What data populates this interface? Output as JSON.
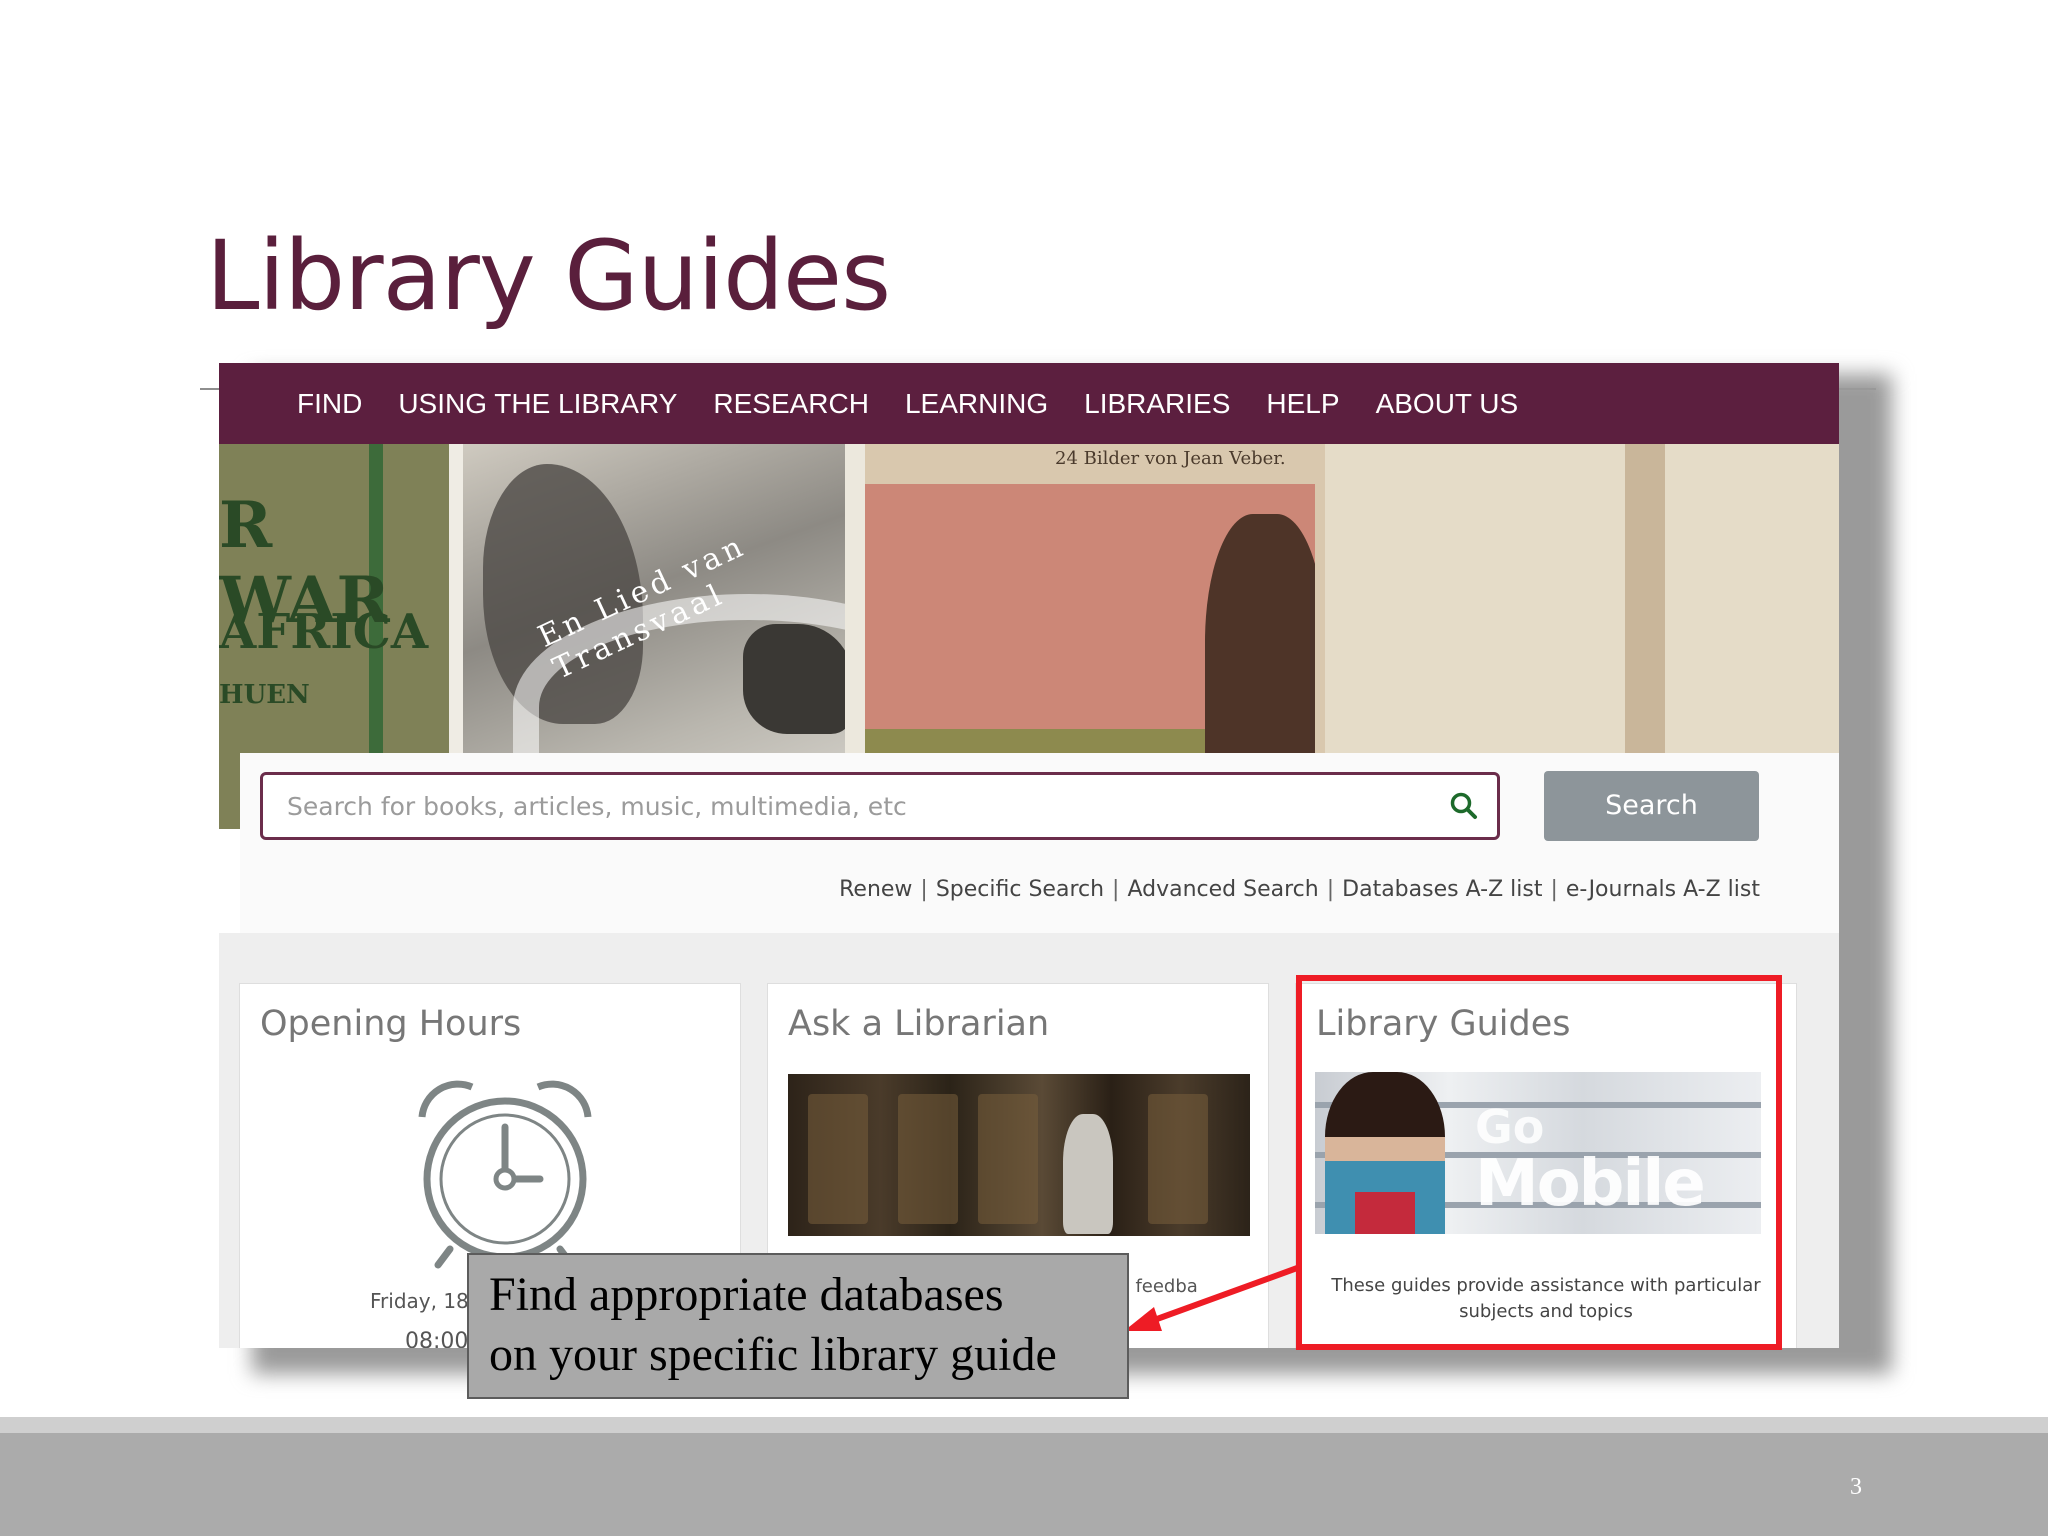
{
  "slide": {
    "title": "Library Guides",
    "page_number": "3"
  },
  "nav": {
    "items": [
      "FIND",
      "USING THE LIBRARY",
      "RESEARCH",
      "LEARNING",
      "LIBRARIES",
      "HELP",
      "ABOUT US"
    ]
  },
  "banner": {
    "panel1_line1": "R WAR",
    "panel1_line2": "AFRICA",
    "panel1_line3": "HUEN",
    "panel2_caption": "En Lied van Transvaal",
    "panel3_caption": "24 Bilder von Jean Veber."
  },
  "search": {
    "placeholder": "Search for books, articles, music, multimedia, etc",
    "button_label": "Search"
  },
  "quick_links": [
    "Renew",
    "Specific Search",
    "Advanced Search",
    "Databases A-Z list",
    "e-Journals A-Z list"
  ],
  "cards": {
    "opening_hours": {
      "title": "Opening Hours",
      "text_visible": "Friday, 18",
      "time_visible": "08:00"
    },
    "ask_librarian": {
      "title": "Ask a Librarian",
      "text_visible": "ve feedba"
    },
    "library_guides": {
      "title": "Library Guides",
      "image_text_1": "Go",
      "image_text_2": "Mobile",
      "description": "These guides provide assistance with particular subjects and topics"
    }
  },
  "callout": {
    "line1": "Find appropriate databases",
    "line2": "on your specific library guide"
  },
  "colors": {
    "brand_maroon": "#5c1f3f",
    "highlight_red": "#ee1c25",
    "callout_gray": "#a9a9a9",
    "button_gray": "#8d959a"
  },
  "icons": {
    "search": "search-icon",
    "clock": "alarm-clock-icon",
    "arrow": "red-arrow-icon"
  }
}
